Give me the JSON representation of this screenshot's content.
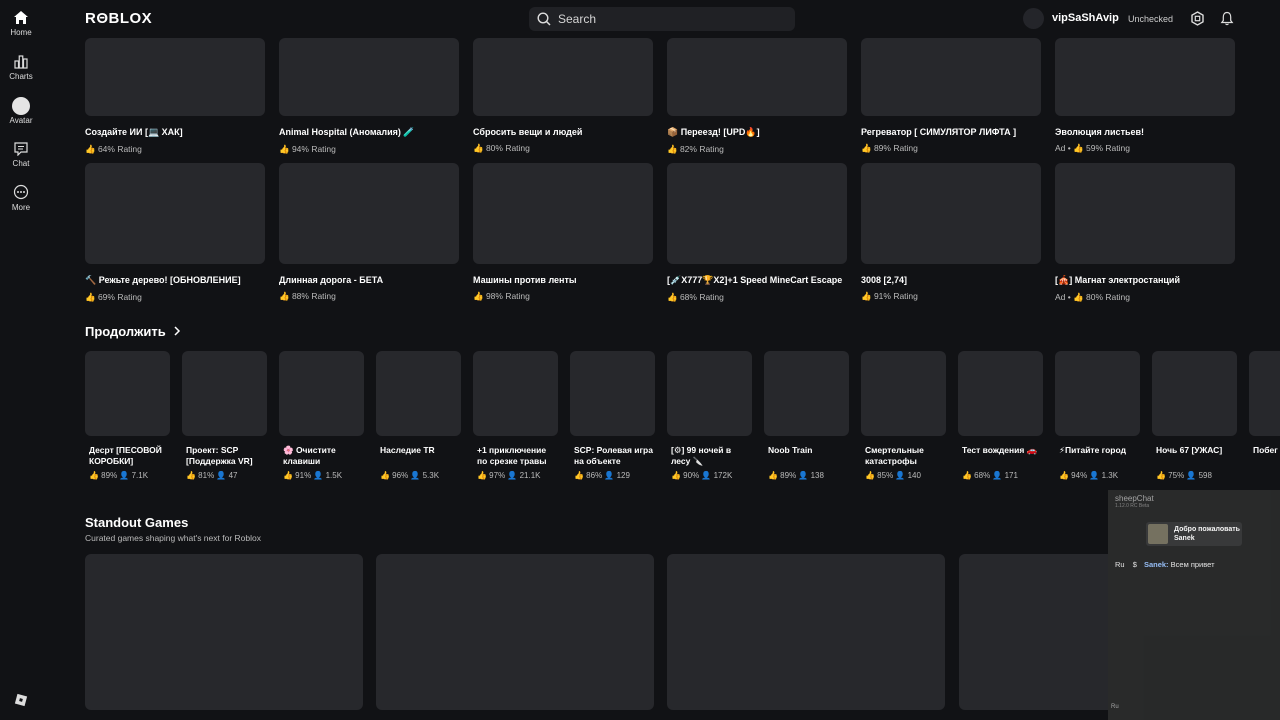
{
  "topbar": {
    "logo": "RΘBLOX",
    "search_placeholder": "Search",
    "username": "vipSaShAvip",
    "account_status": "Unchecked"
  },
  "sidebar": {
    "items": [
      {
        "label": "Home",
        "icon": "home-icon"
      },
      {
        "label": "Charts",
        "icon": "charts-icon"
      },
      {
        "label": "Avatar",
        "icon": "avatar-icon"
      },
      {
        "label": "Chat",
        "icon": "chat-icon"
      },
      {
        "label": "More",
        "icon": "more-icon"
      }
    ]
  },
  "games_row1": [
    {
      "title": "Создайте ИИ [💻 ХАК]",
      "rating": "👍 64% Rating"
    },
    {
      "title": "Animal Hospital (Аномалия) 🧪",
      "rating": "👍 94% Rating"
    },
    {
      "title": "Сбросить вещи и людей",
      "rating": "👍 80% Rating"
    },
    {
      "title": "📦 Переезд! [UPD🔥]",
      "rating": "👍 82% Rating"
    },
    {
      "title": "Регреватор [ СИМУЛЯТОР ЛИФТА ]",
      "rating": "👍 89% Rating"
    },
    {
      "title": "Эволюция листьев!",
      "rating": "Ad • 👍 59% Rating"
    }
  ],
  "games_row2": [
    {
      "title": "🔨 Режьте дерево! [ОБНОВЛЕНИЕ]",
      "rating": "👍 69% Rating"
    },
    {
      "title": "Длинная дорога - БЕТА",
      "rating": "👍 88% Rating"
    },
    {
      "title": "Машины против ленты",
      "rating": "👍 98% Rating"
    },
    {
      "title": "[💉X777🏆X2]+1 Speed MineCart Escape",
      "rating": "👍 68% Rating"
    },
    {
      "title": "3008 [2,74]",
      "rating": "👍 91% Rating"
    },
    {
      "title": "[🎪] Магнат электростанций",
      "rating": "Ad • 👍 80% Rating"
    }
  ],
  "continue": {
    "title": "Продолжить",
    "items": [
      {
        "title": "Десрт [ПЕСОВОЙ КОРОБКИ]",
        "stats": "👍 89%  👤 7.1K"
      },
      {
        "title": "Проект: SCP [Поддержка VR]",
        "stats": "👍 81%  👤 47"
      },
      {
        "title": "🌸 Очистите клавиши",
        "stats": "👍 91%  👤 1.5K"
      },
      {
        "title": "Наследие TR",
        "stats": "👍 96%  👤 5.3K"
      },
      {
        "title": "+1 приключение по срезке травы",
        "stats": "👍 97%  👤 21.1K"
      },
      {
        "title": "SCP: Ролевая игра на объекте",
        "stats": "👍 86%  👤 129"
      },
      {
        "title": "[⚙] 99 ночей в лесу 🔪",
        "stats": "👍 90%  👤 172K"
      },
      {
        "title": "Noob Train",
        "stats": "👍 89%  👤 138"
      },
      {
        "title": "Смертельные катастрофы",
        "stats": "👍 85%  👤 140"
      },
      {
        "title": "Тест вождения 🚗",
        "stats": "👍 68%  👤 171"
      },
      {
        "title": "⚡Питайте город",
        "stats": "👍 94%  👤 1.3K"
      },
      {
        "title": "Ночь 67 [УЖАС]",
        "stats": "👍 75%  👤 598"
      },
      {
        "title": "Побег для М",
        "stats": ""
      }
    ]
  },
  "standout": {
    "title": "Standout Games",
    "subtitle": "Curated games shaping what's next for Roblox"
  },
  "chat_overlay": {
    "title": "sheepChat",
    "version": "1.12.0 RC Beta",
    "welcome": "Добро пожаловать Sanek",
    "message_prefix": "Ru",
    "message_user": "Sanek:",
    "message_text": "Всем привет",
    "footer": "Ru"
  }
}
